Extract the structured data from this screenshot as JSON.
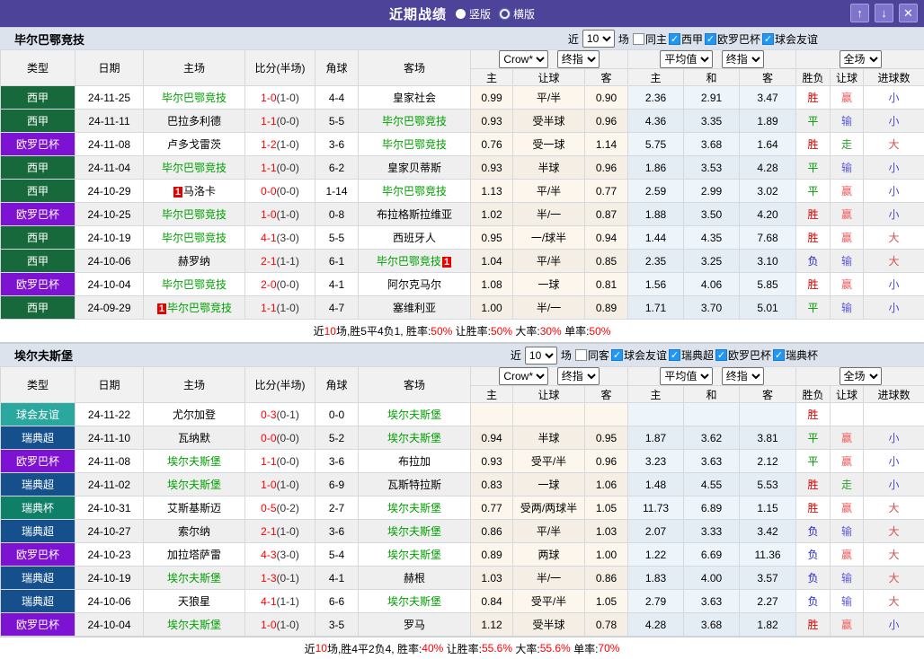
{
  "header": {
    "title": "近期战绩",
    "radio_vertical": "竖版",
    "radio_horizontal": "横版",
    "buttons": {
      "up": "↑",
      "down": "↓",
      "close": "✕"
    },
    "bar_color": "#4d4399"
  },
  "table_header": {
    "cols": {
      "type": "类型",
      "date": "日期",
      "home": "主场",
      "score": "比分(半场)",
      "corner": "角球",
      "away": "客场"
    },
    "selects": {
      "odds_source": "Crow*",
      "final1": "终指",
      "average": "平均值",
      "final2": "终指",
      "scope": "全场"
    },
    "sub": [
      "主",
      "让球",
      "客",
      "主",
      "和",
      "客",
      "胜负",
      "让球",
      "进球数"
    ]
  },
  "league_colors": {
    "西甲": "#17693b",
    "欧罗巴杯": "#7d12d3",
    "球会友谊": "#2aa89d",
    "瑞典超": "#15508d",
    "瑞典杯": "#0f7f68"
  },
  "result_colors": {
    "胜": "#e60000",
    "平": "#009900",
    "负": "#2323cc",
    "赢": "#f05a5a",
    "输": "#5a5ad8",
    "走": "#2f9f2f",
    "大": "#d85050",
    "小": "#4a4acc"
  },
  "sections": [
    {
      "team": "毕尔巴鄂竞技",
      "filter": {
        "prefix": "近",
        "match_count": "10",
        "suffix": "场",
        "same_label": "同主",
        "same_checked": false,
        "leagues": [
          "西甲",
          "欧罗巴杯",
          "球会友谊"
        ]
      },
      "rows": [
        {
          "league": "西甲",
          "date": "24-11-25",
          "home": {
            "name": "毕尔巴鄂竞技",
            "green": true
          },
          "away": {
            "name": "皇家社会",
            "green": false
          },
          "score": "1-0",
          "half": "(1-0)",
          "corner": "4-4",
          "odds": [
            "0.99",
            "平/半",
            "0.90"
          ],
          "avg": [
            "2.36",
            "2.91",
            "3.47"
          ],
          "results": [
            "胜",
            "赢",
            "小"
          ]
        },
        {
          "league": "西甲",
          "date": "24-11-11",
          "home": {
            "name": "巴拉多利德",
            "green": false
          },
          "away": {
            "name": "毕尔巴鄂竞技",
            "green": true
          },
          "score": "1-1",
          "half": "(0-0)",
          "corner": "5-5",
          "odds": [
            "0.93",
            "受半球",
            "0.96"
          ],
          "avg": [
            "4.36",
            "3.35",
            "1.89"
          ],
          "results": [
            "平",
            "输",
            "小"
          ]
        },
        {
          "league": "欧罗巴杯",
          "date": "24-11-08",
          "home": {
            "name": "卢多戈雷茨",
            "green": false
          },
          "away": {
            "name": "毕尔巴鄂竞技",
            "green": true
          },
          "score": "1-2",
          "half": "(1-0)",
          "corner": "3-6",
          "odds": [
            "0.76",
            "受一球",
            "1.14"
          ],
          "avg": [
            "5.75",
            "3.68",
            "1.64"
          ],
          "results": [
            "胜",
            "走",
            "大"
          ]
        },
        {
          "league": "西甲",
          "date": "24-11-04",
          "home": {
            "name": "毕尔巴鄂竞技",
            "green": true
          },
          "away": {
            "name": "皇家贝蒂斯",
            "green": false
          },
          "score": "1-1",
          "half": "(0-0)",
          "corner": "6-2",
          "odds": [
            "0.93",
            "半球",
            "0.96"
          ],
          "avg": [
            "1.86",
            "3.53",
            "4.28"
          ],
          "results": [
            "平",
            "输",
            "小"
          ]
        },
        {
          "league": "西甲",
          "date": "24-10-29",
          "home": {
            "name": "马洛卡",
            "green": false,
            "mark_pre": "1"
          },
          "away": {
            "name": "毕尔巴鄂竞技",
            "green": true
          },
          "score": "0-0",
          "half": "(0-0)",
          "corner": "1-14",
          "odds": [
            "1.13",
            "平/半",
            "0.77"
          ],
          "avg": [
            "2.59",
            "2.99",
            "3.02"
          ],
          "results": [
            "平",
            "赢",
            "小"
          ]
        },
        {
          "league": "欧罗巴杯",
          "date": "24-10-25",
          "home": {
            "name": "毕尔巴鄂竞技",
            "green": true
          },
          "away": {
            "name": "布拉格斯拉维亚",
            "green": false
          },
          "score": "1-0",
          "half": "(1-0)",
          "corner": "0-8",
          "odds": [
            "1.02",
            "半/一",
            "0.87"
          ],
          "avg": [
            "1.88",
            "3.50",
            "4.20"
          ],
          "results": [
            "胜",
            "赢",
            "小"
          ]
        },
        {
          "league": "西甲",
          "date": "24-10-19",
          "home": {
            "name": "毕尔巴鄂竞技",
            "green": true
          },
          "away": {
            "name": "西班牙人",
            "green": false
          },
          "score": "4-1",
          "half": "(3-0)",
          "corner": "5-5",
          "odds": [
            "0.95",
            "一/球半",
            "0.94"
          ],
          "avg": [
            "1.44",
            "4.35",
            "7.68"
          ],
          "results": [
            "胜",
            "赢",
            "大"
          ]
        },
        {
          "league": "西甲",
          "date": "24-10-06",
          "home": {
            "name": "赫罗纳",
            "green": false
          },
          "away": {
            "name": "毕尔巴鄂竞技",
            "green": true,
            "mark_post": "1"
          },
          "score": "2-1",
          "half": "(1-1)",
          "corner": "6-1",
          "odds": [
            "1.04",
            "平/半",
            "0.85"
          ],
          "avg": [
            "2.35",
            "3.25",
            "3.10"
          ],
          "results": [
            "负",
            "输",
            "大"
          ]
        },
        {
          "league": "欧罗巴杯",
          "date": "24-10-04",
          "home": {
            "name": "毕尔巴鄂竞技",
            "green": true
          },
          "away": {
            "name": "阿尔克马尔",
            "green": false
          },
          "score": "2-0",
          "half": "(0-0)",
          "corner": "4-1",
          "odds": [
            "1.08",
            "一球",
            "0.81"
          ],
          "avg": [
            "1.56",
            "4.06",
            "5.85"
          ],
          "results": [
            "胜",
            "赢",
            "小"
          ]
        },
        {
          "league": "西甲",
          "date": "24-09-29",
          "home": {
            "name": "毕尔巴鄂竞技",
            "green": true,
            "mark_pre": "1"
          },
          "away": {
            "name": "塞维利亚",
            "green": false
          },
          "score": "1-1",
          "half": "(1-0)",
          "corner": "4-7",
          "odds": [
            "1.00",
            "半/一",
            "0.89"
          ],
          "avg": [
            "1.71",
            "3.70",
            "5.01"
          ],
          "results": [
            "平",
            "输",
            "小"
          ]
        }
      ],
      "summary": [
        {
          "text": "近",
          "red": false
        },
        {
          "text": "10",
          "red": true
        },
        {
          "text": "场,胜5平4负1, 胜率:",
          "red": false
        },
        {
          "text": "50%",
          "red": true
        },
        {
          "text": " 让胜率:",
          "red": false
        },
        {
          "text": "50%",
          "red": true
        },
        {
          "text": " 大率:",
          "red": false
        },
        {
          "text": "30%",
          "red": true
        },
        {
          "text": " 单率:",
          "red": false
        },
        {
          "text": "50%",
          "red": true
        }
      ]
    },
    {
      "team": "埃尔夫斯堡",
      "filter": {
        "prefix": "近",
        "match_count": "10",
        "suffix": "场",
        "same_label": "同客",
        "same_checked": false,
        "leagues": [
          "球会友谊",
          "瑞典超",
          "欧罗巴杯",
          "瑞典杯"
        ]
      },
      "rows": [
        {
          "league": "球会友谊",
          "date": "24-11-22",
          "home": {
            "name": "尤尔加登",
            "green": false
          },
          "away": {
            "name": "埃尔夫斯堡",
            "green": true
          },
          "score": "0-3",
          "half": "(0-1)",
          "corner": "0-0",
          "odds": [
            "",
            "",
            ""
          ],
          "avg": [
            "",
            "",
            ""
          ],
          "results": [
            "胜",
            "",
            ""
          ]
        },
        {
          "league": "瑞典超",
          "date": "24-11-10",
          "home": {
            "name": "瓦纳默",
            "green": false
          },
          "away": {
            "name": "埃尔夫斯堡",
            "green": true
          },
          "score": "0-0",
          "half": "(0-0)",
          "corner": "5-2",
          "odds": [
            "0.94",
            "半球",
            "0.95"
          ],
          "avg": [
            "1.87",
            "3.62",
            "3.81"
          ],
          "results": [
            "平",
            "赢",
            "小"
          ]
        },
        {
          "league": "欧罗巴杯",
          "date": "24-11-08",
          "home": {
            "name": "埃尔夫斯堡",
            "green": true
          },
          "away": {
            "name": "布拉加",
            "green": false
          },
          "score": "1-1",
          "half": "(0-0)",
          "corner": "3-6",
          "odds": [
            "0.93",
            "受平/半",
            "0.96"
          ],
          "avg": [
            "3.23",
            "3.63",
            "2.12"
          ],
          "results": [
            "平",
            "赢",
            "小"
          ]
        },
        {
          "league": "瑞典超",
          "date": "24-11-02",
          "home": {
            "name": "埃尔夫斯堡",
            "green": true
          },
          "away": {
            "name": "瓦斯特拉斯",
            "green": false
          },
          "score": "1-0",
          "half": "(1-0)",
          "corner": "6-9",
          "odds": [
            "0.83",
            "一球",
            "1.06"
          ],
          "avg": [
            "1.48",
            "4.55",
            "5.53"
          ],
          "results": [
            "胜",
            "走",
            "小"
          ]
        },
        {
          "league": "瑞典杯",
          "date": "24-10-31",
          "home": {
            "name": "艾斯基斯迈",
            "green": false
          },
          "away": {
            "name": "埃尔夫斯堡",
            "green": true
          },
          "score": "0-5",
          "half": "(0-2)",
          "corner": "2-7",
          "odds": [
            "0.77",
            "受两/两球半",
            "1.05"
          ],
          "avg": [
            "11.73",
            "6.89",
            "1.15"
          ],
          "results": [
            "胜",
            "赢",
            "大"
          ]
        },
        {
          "league": "瑞典超",
          "date": "24-10-27",
          "home": {
            "name": "索尔纳",
            "green": false
          },
          "away": {
            "name": "埃尔夫斯堡",
            "green": true
          },
          "score": "2-1",
          "half": "(1-0)",
          "corner": "3-6",
          "odds": [
            "0.86",
            "平/半",
            "1.03"
          ],
          "avg": [
            "2.07",
            "3.33",
            "3.42"
          ],
          "results": [
            "负",
            "输",
            "大"
          ]
        },
        {
          "league": "欧罗巴杯",
          "date": "24-10-23",
          "home": {
            "name": "加拉塔萨雷",
            "green": false
          },
          "away": {
            "name": "埃尔夫斯堡",
            "green": true
          },
          "score": "4-3",
          "half": "(3-0)",
          "corner": "5-4",
          "odds": [
            "0.89",
            "两球",
            "1.00"
          ],
          "avg": [
            "1.22",
            "6.69",
            "11.36"
          ],
          "results": [
            "负",
            "赢",
            "大"
          ]
        },
        {
          "league": "瑞典超",
          "date": "24-10-19",
          "home": {
            "name": "埃尔夫斯堡",
            "green": true
          },
          "away": {
            "name": "赫根",
            "green": false
          },
          "score": "1-3",
          "half": "(0-1)",
          "corner": "4-1",
          "odds": [
            "1.03",
            "半/一",
            "0.86"
          ],
          "avg": [
            "1.83",
            "4.00",
            "3.57"
          ],
          "results": [
            "负",
            "输",
            "大"
          ]
        },
        {
          "league": "瑞典超",
          "date": "24-10-06",
          "home": {
            "name": "天狼星",
            "green": false
          },
          "away": {
            "name": "埃尔夫斯堡",
            "green": true
          },
          "score": "4-1",
          "half": "(1-1)",
          "corner": "6-6",
          "odds": [
            "0.84",
            "受平/半",
            "1.05"
          ],
          "avg": [
            "2.79",
            "3.63",
            "2.27"
          ],
          "results": [
            "负",
            "输",
            "大"
          ]
        },
        {
          "league": "欧罗巴杯",
          "date": "24-10-04",
          "home": {
            "name": "埃尔夫斯堡",
            "green": true
          },
          "away": {
            "name": "罗马",
            "green": false
          },
          "score": "1-0",
          "half": "(1-0)",
          "corner": "3-5",
          "odds": [
            "1.12",
            "受半球",
            "0.78"
          ],
          "avg": [
            "4.28",
            "3.68",
            "1.82"
          ],
          "results": [
            "胜",
            "赢",
            "小"
          ]
        }
      ],
      "summary": [
        {
          "text": "近",
          "red": false
        },
        {
          "text": "10",
          "red": true
        },
        {
          "text": "场,胜4平2负4, 胜率:",
          "red": false
        },
        {
          "text": "40%",
          "red": true
        },
        {
          "text": " 让胜率:",
          "red": false
        },
        {
          "text": "55.6%",
          "red": true
        },
        {
          "text": " 大率:",
          "red": false
        },
        {
          "text": "55.6%",
          "red": true
        },
        {
          "text": " 单率:",
          "red": false
        },
        {
          "text": "70%",
          "red": true
        }
      ]
    }
  ]
}
